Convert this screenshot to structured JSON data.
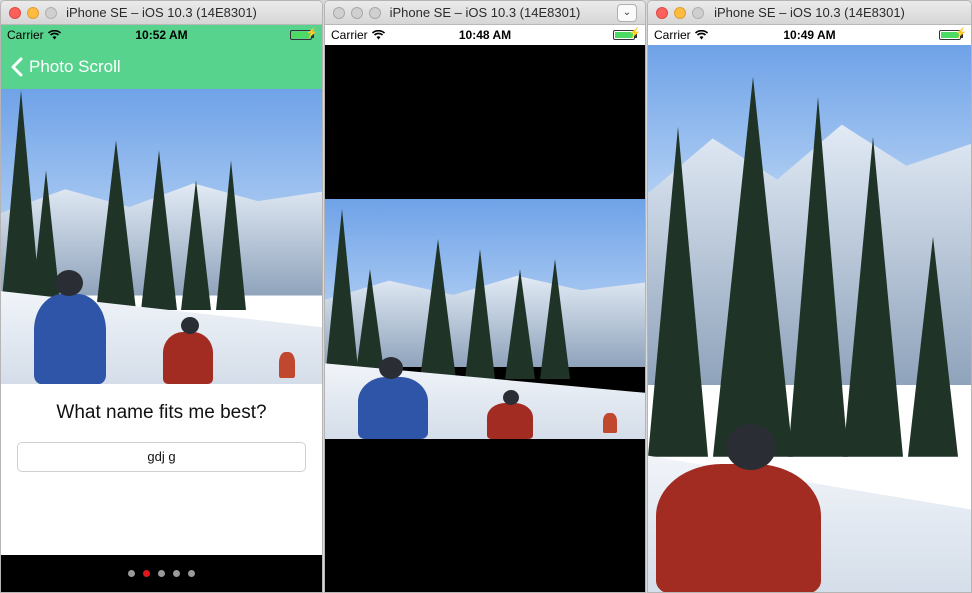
{
  "windows": [
    {
      "title": "iPhone SE – iOS 10.3 (14E8301)",
      "status": {
        "carrier": "Carrier",
        "time": "10:52 AM"
      },
      "nav": {
        "back_label": "Photo Scroll"
      },
      "question": "What name fits me best?",
      "answer_value": "gdj g",
      "page_count": 5,
      "current_page": 2
    },
    {
      "title": "iPhone SE – iOS 10.3 (14E8301)",
      "status": {
        "carrier": "Carrier",
        "time": "10:48 AM"
      }
    },
    {
      "title": "iPhone SE – iOS 10.3 (14E8301)",
      "status": {
        "carrier": "Carrier",
        "time": "10:49 AM"
      }
    }
  ],
  "colors": {
    "nav_bar": "#58d38e",
    "active_dot": "#e0181b",
    "inactive_dot": "#9a9a9a"
  }
}
